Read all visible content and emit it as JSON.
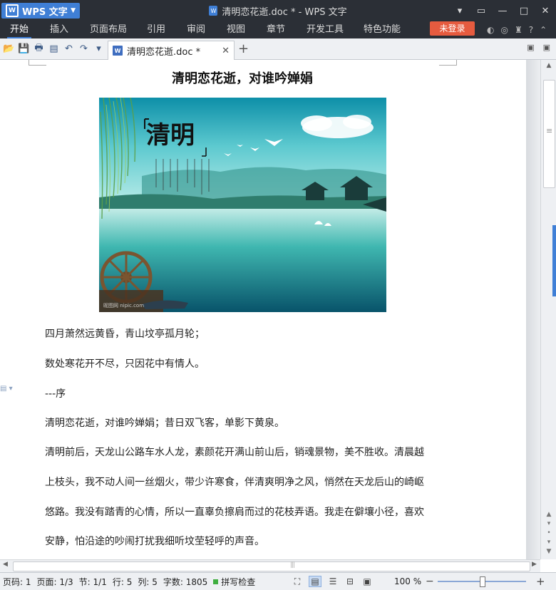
{
  "app": {
    "name": "WPS 文字",
    "window_title": "清明恋花逝.doc * - WPS 文字"
  },
  "window_controls": [
    "▾",
    "▭",
    "—",
    "□",
    "✕"
  ],
  "menu": {
    "tabs": [
      "开始",
      "插入",
      "页面布局",
      "引用",
      "审阅",
      "视图",
      "章节",
      "开发工具",
      "特色功能"
    ],
    "active_tab": "开始",
    "login_label": "未登录",
    "right_icons": [
      "◐",
      "◎",
      "♜",
      "?",
      "⌃"
    ]
  },
  "toolbar": {
    "quick_icons": [
      "📂",
      "💾",
      "🖶",
      "▤",
      "↶",
      "↷",
      "▾"
    ],
    "doc_tab_name": "清明恋花逝.doc *",
    "doc_tab_close": "✕",
    "new_tab": "+",
    "right_icons": [
      "▣",
      "▣"
    ]
  },
  "document": {
    "title": "清明恋花逝，对谁吟婵娟",
    "poster": {
      "calligraphy": "清明",
      "watermark": "昵图网 nipic.com"
    },
    "paragraphs": [
      "四月萧然远黄昏，青山坟亭孤月轮；",
      "数处寒花开不尽，只因花中有情人。",
      "---序",
      "清明恋花逝，对谁吟婵娟；昔日双飞客，单影下黄泉。",
      "清明前后，天龙山公路车水人龙，素颜花开满山前山后，销魂景物，美不胜收。清晨越",
      "上枝头，我不动人间一丝烟火，带少许寒食，伴清爽明净之风，悄然在天龙后山的崎岖",
      "悠路。我没有踏青的心情，所以一直辜负擦肩而过的花枝弄语。我走在僻壤小径，喜欢",
      "安静，怕沿途的吵闹打扰我细听坟茔轻呼的声音。"
    ]
  },
  "status": {
    "page_code": "页码: 1",
    "page": "页面: 1/3",
    "section": "节: 1/1",
    "row": "行: 5",
    "col": "列: 5",
    "word_count": "字数: 1805",
    "spell_check": "拼写检查",
    "zoom": "100 %",
    "zoom_level": 0.5,
    "view_icons": [
      "⛶",
      "▤",
      "☰",
      "⊟",
      "▣"
    ]
  },
  "colors": {
    "titlebar": "#2b2f36",
    "accent": "#3f7fd6",
    "login": "#e65b3f"
  }
}
